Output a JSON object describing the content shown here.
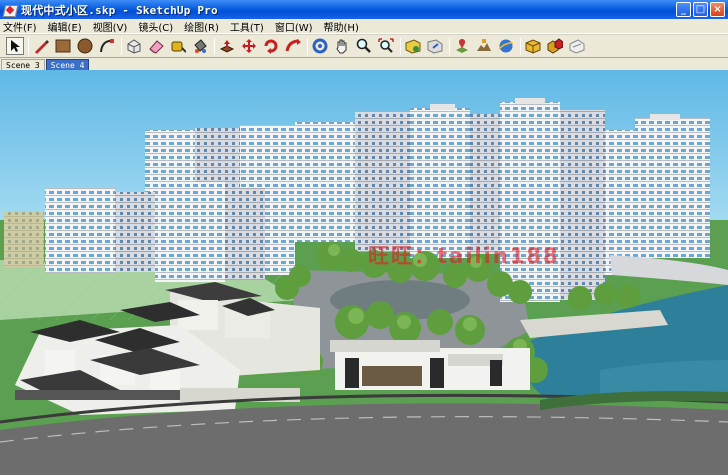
{
  "window": {
    "title": "现代中式小区.skp - SketchUp Pro",
    "minimize_glyph": "_",
    "maximize_glyph": "□",
    "close_glyph": "×"
  },
  "menu": [
    {
      "label": "文件(F)"
    },
    {
      "label": "编辑(E)"
    },
    {
      "label": "视图(V)"
    },
    {
      "label": "镜头(C)"
    },
    {
      "label": "绘图(R)"
    },
    {
      "label": "工具(T)"
    },
    {
      "label": "窗口(W)"
    },
    {
      "label": "帮助(H)"
    }
  ],
  "toolbar": [
    {
      "icon": "select-arrow-icon",
      "selected": true
    },
    {
      "icon": "pencil-line-icon"
    },
    {
      "icon": "rectangle-icon"
    },
    {
      "icon": "circle-icon"
    },
    {
      "icon": "arc-icon"
    },
    {
      "icon": "make-component-icon"
    },
    {
      "icon": "eraser-icon"
    },
    {
      "icon": "tape-measure-icon"
    },
    {
      "icon": "paint-bucket-icon"
    },
    {
      "icon": "push-pull-icon"
    },
    {
      "icon": "move-icon"
    },
    {
      "icon": "rotate-icon"
    },
    {
      "icon": "follow-me-icon"
    },
    {
      "icon": "orbit-icon"
    },
    {
      "icon": "pan-hand-icon"
    },
    {
      "icon": "zoom-icon"
    },
    {
      "icon": "zoom-extents-icon"
    },
    {
      "icon": "get-models-icon"
    },
    {
      "icon": "share-model-icon"
    },
    {
      "icon": "add-location-icon"
    },
    {
      "icon": "toggle-terrain-icon"
    },
    {
      "icon": "google-earth-icon"
    },
    {
      "icon": "components-icon"
    },
    {
      "icon": "extension-warehouse-icon"
    },
    {
      "icon": "layout-send-icon"
    }
  ],
  "scenes": [
    {
      "label": "Scene 3",
      "active": false
    },
    {
      "label": "Scene 4",
      "active": true
    }
  ],
  "viewport": {
    "watermark": "旺旺：tailin188",
    "sky_color": "#8fd1ef",
    "grass_color": "#4f9a4a",
    "water_color": "#2e7f9a",
    "road_color": "#6b6b6b"
  }
}
